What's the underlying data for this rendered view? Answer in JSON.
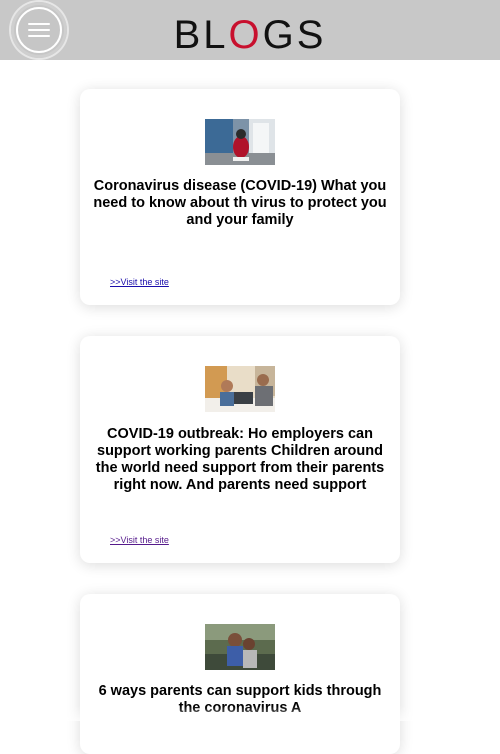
{
  "header": {
    "logo_prefix": "BL",
    "logo_accent": "O",
    "logo_suffix": "GS",
    "accent_color": "#c8102e",
    "background_color": "#c8c8c8",
    "menu_icon": "hamburger-menu-icon"
  },
  "posts": [
    {
      "title": "Coronavirus disease (COVID-19) What you need to know about th virus to protect you and your family",
      "link_label": ">>Visit the site",
      "image": "child-in-red-jacket-by-window-photo"
    },
    {
      "title": "COVID-19 outbreak: Ho employers can support working parents Children around the world need support from their parents right now. And parents need support",
      "link_label": ">>Visit the site",
      "image": "parent-and-child-at-laptop-photo"
    },
    {
      "title": "6 ways parents can support kids through the coronavirus A",
      "link_label": "",
      "image": "parent-hugging-child-photo"
    }
  ]
}
